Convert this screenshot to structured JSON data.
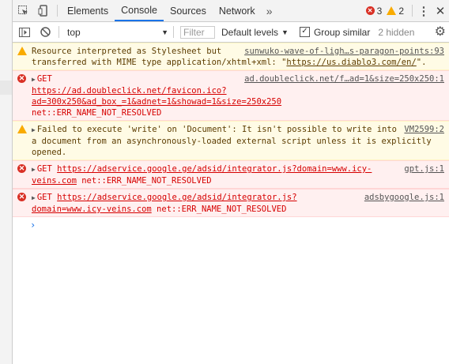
{
  "tabs": [
    {
      "label": "Elements"
    },
    {
      "label": "Console"
    },
    {
      "label": "Sources"
    },
    {
      "label": "Network"
    }
  ],
  "toolbar": {
    "more_glyph": "»",
    "error_count": "3",
    "warning_count": "2",
    "kebab_glyph": "⋮",
    "close_glyph": "✕"
  },
  "filterbar": {
    "context": "top",
    "filter_placeholder": "Filter",
    "levels_label": "Default levels",
    "group_similar_label": "Group similar",
    "hidden_label": "2 hidden"
  },
  "messages": [
    {
      "level": "warning",
      "text1": "Resource interpreted as Stylesheet ",
      "source": "sunwuko-wave-of-ligh…s-paragon-points:93",
      "text2": " but transferred with MIME type application/xhtml+xml: \"",
      "link": "https://us.diablo3.com/en/",
      "text3": "\"."
    },
    {
      "level": "error",
      "prefix": "GET ",
      "link": "https://ad.doubleclick.net/favicon.ico?ad=300x250&ad_box_=1&adnet=1&showad=1&size=250x250",
      "source": "ad.doubleclick.net/f…ad=1&size=250x250:1",
      "suffix": "net::ERR_NAME_NOT_RESOLVED"
    },
    {
      "level": "warning",
      "text": "Failed to execute 'write' on 'Document': It isn't possible to write into a document from an asynchronously-loaded external script unless it is explicitly opened.",
      "source": "VM2599:2"
    },
    {
      "level": "error",
      "prefix": "GET ",
      "link": "https://adservice.google.ge/adsid/integrator.js?domain=www.icy-veins.com",
      "source": "gpt.js:1",
      "suffix": "net::ERR_NAME_NOT_RESOLVED"
    },
    {
      "level": "error",
      "prefix": "GET ",
      "link": "https://adservice.google.ge/adsid/integrator.js?domain=www.icy-veins.com",
      "source": "adsbygoogle.js:1",
      "suffix": "net::ERR_NAME_NOT_RESOLVED"
    }
  ],
  "prompt_glyph": "›",
  "icons": {
    "inspect": "inspect-element-icon",
    "device": "device-toolbar-icon",
    "sidebar": "console-sidebar-icon",
    "clear": "clear-console-icon",
    "settings": "settings-gear-icon"
  },
  "colors": {
    "error_bg": "#fff0f0",
    "error_text": "#d60000",
    "warning_bg": "#fffbe5",
    "warning_text": "#5c3c00",
    "active_tab": "#1a73e8"
  }
}
